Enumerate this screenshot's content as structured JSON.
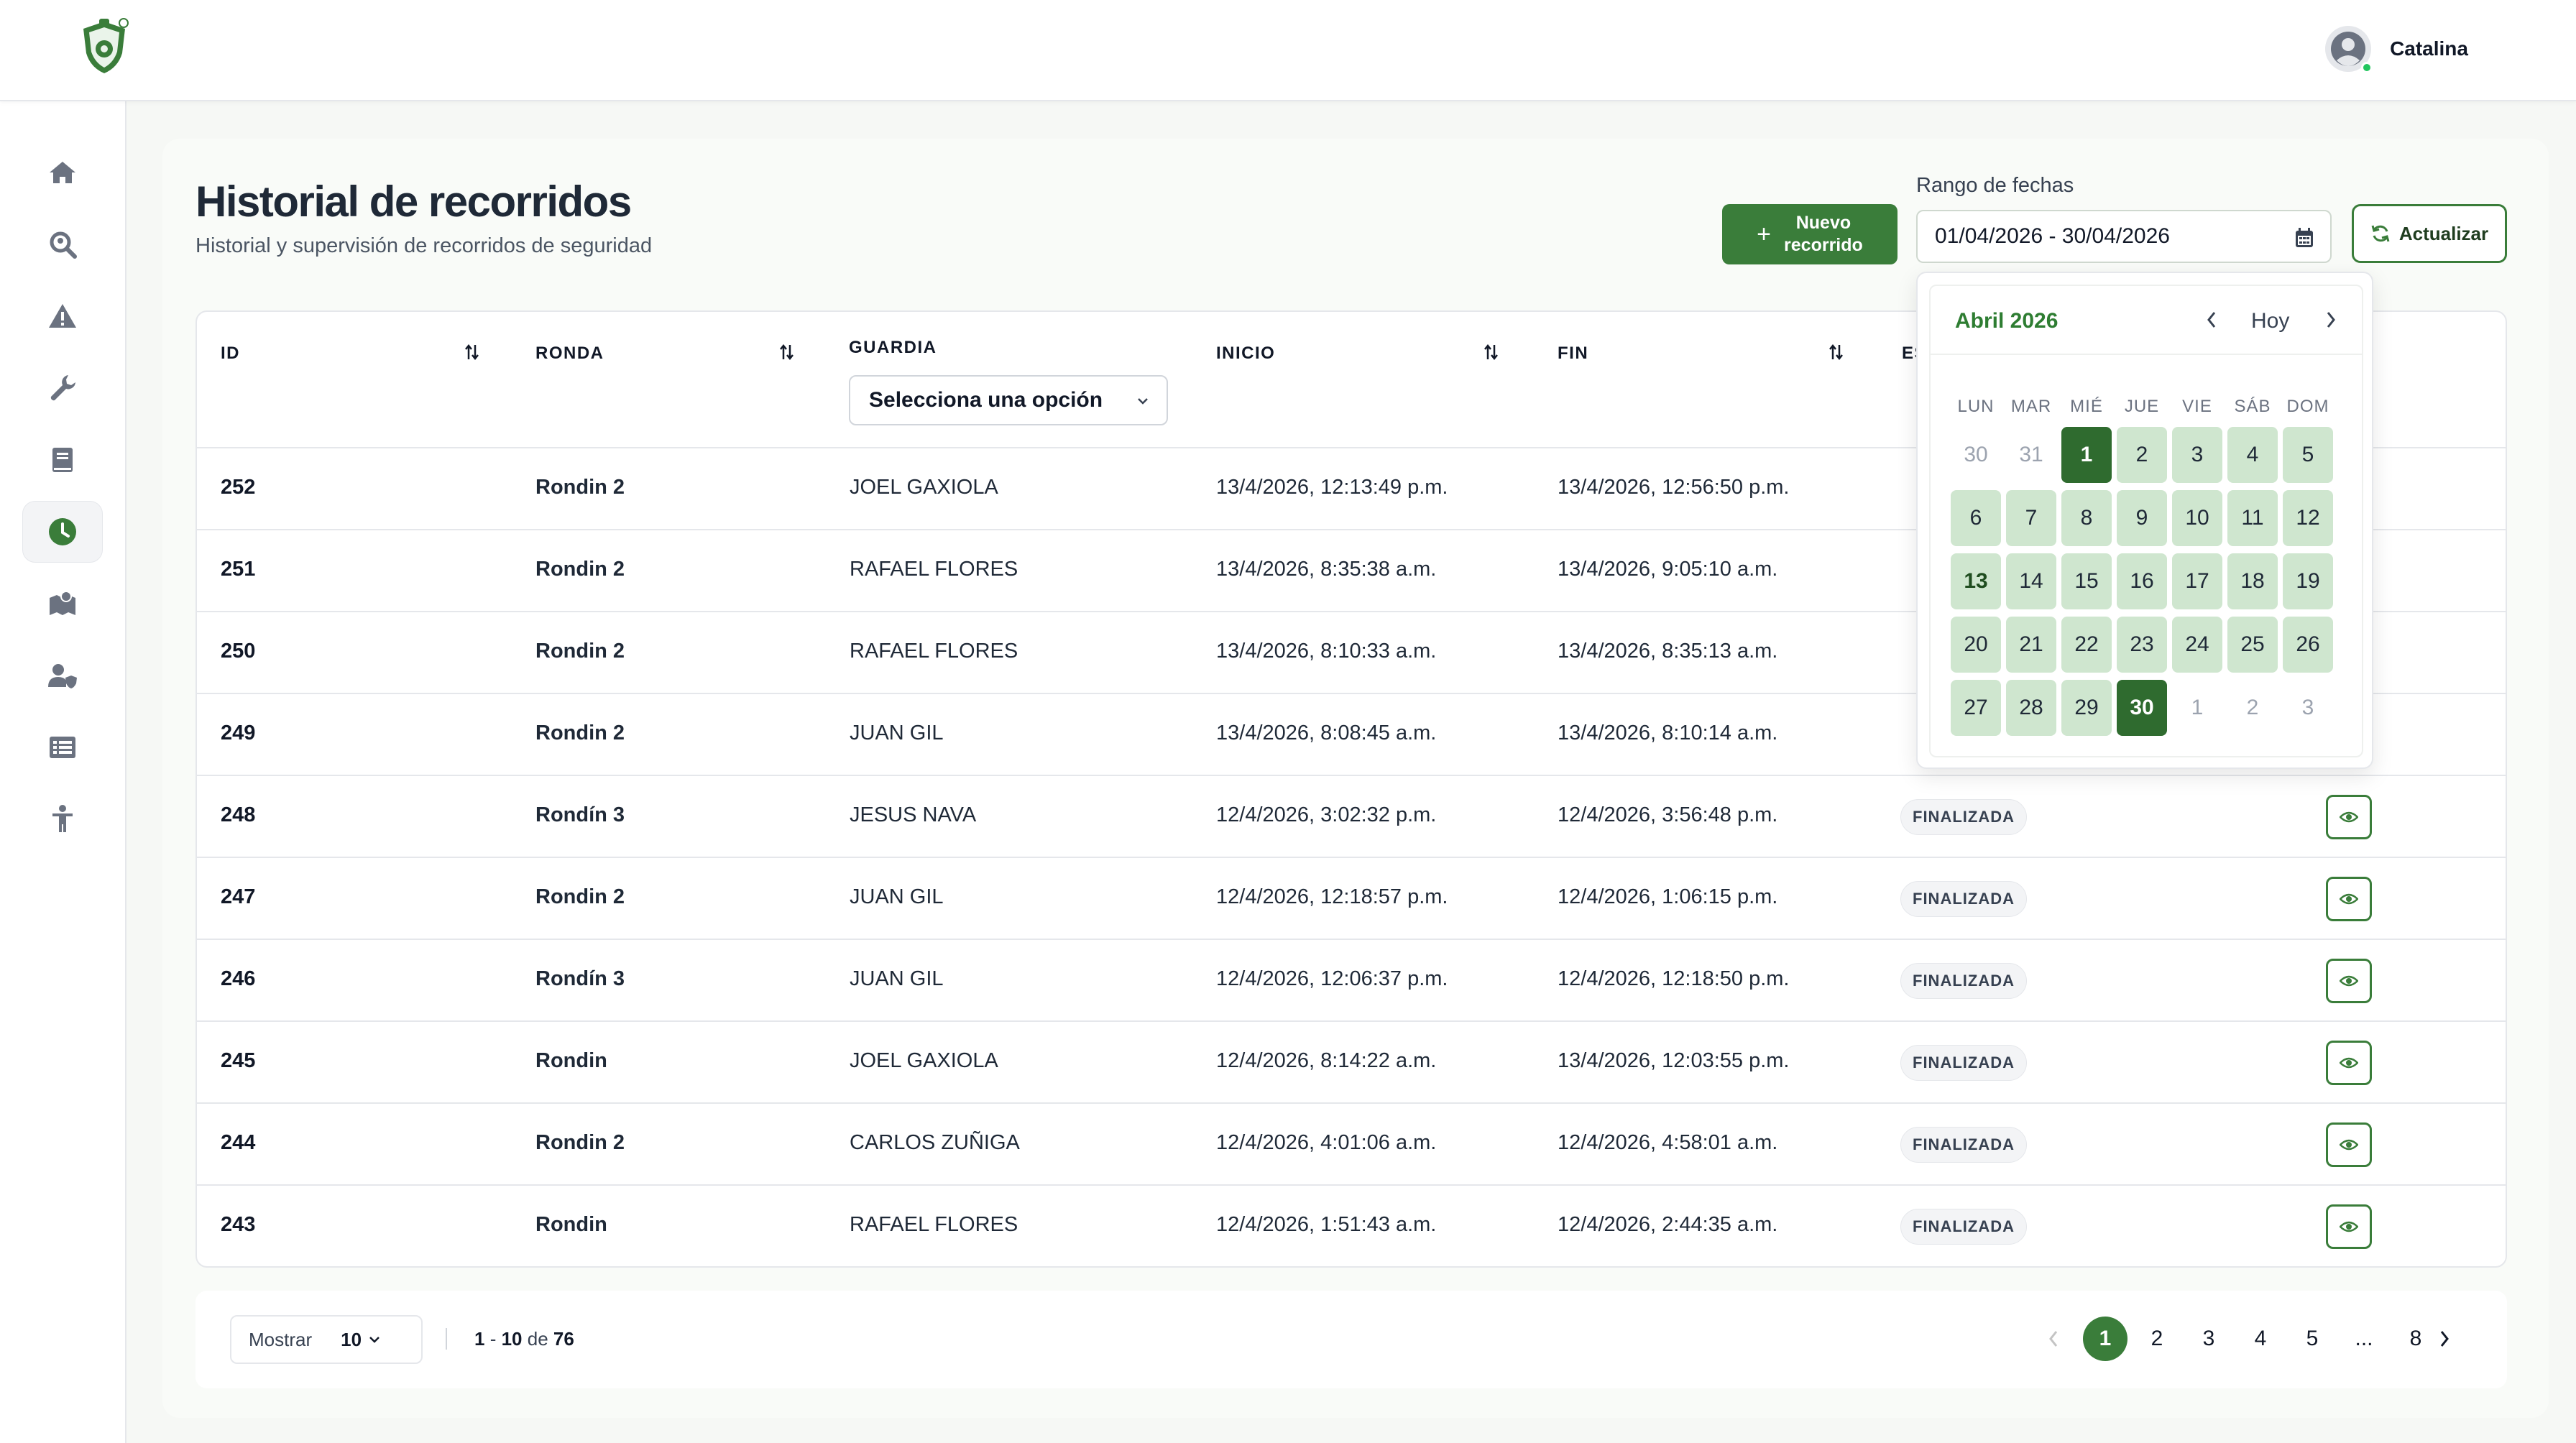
{
  "colors": {
    "accent": "#3a7d3a",
    "accent_dark": "#2f6b2f",
    "range_day_bg": "#cfe6cf",
    "online": "#22c55e"
  },
  "header": {
    "user_name": "Catalina"
  },
  "sidebar": {
    "items": [
      {
        "name": "home",
        "icon": "home-icon"
      },
      {
        "name": "search",
        "icon": "search-location-icon"
      },
      {
        "name": "alerts",
        "icon": "warning-icon"
      },
      {
        "name": "tools",
        "icon": "wrench-icon"
      },
      {
        "name": "logbook",
        "icon": "book-icon"
      },
      {
        "name": "history",
        "icon": "clock-icon",
        "active": true
      },
      {
        "name": "map",
        "icon": "map-icon"
      },
      {
        "name": "users",
        "icon": "user-shield-icon"
      },
      {
        "name": "list",
        "icon": "list-icon"
      },
      {
        "name": "guard",
        "icon": "person-icon"
      }
    ]
  },
  "page": {
    "title": "Historial de recorridos",
    "subtitle": "Historial y supervisión de recorridos de seguridad",
    "new_button": {
      "plus": "+",
      "label": "Nuevo recorrido"
    },
    "range_label": "Rango de fechas",
    "range_value": "01/04/2026 - 30/04/2026",
    "refresh_button": "Actualizar"
  },
  "table": {
    "headers": {
      "id": "ID",
      "ronda": "RONDA",
      "guardia": "GUARDIA",
      "inicio": "INICIO",
      "fin": "FIN",
      "estado": "ES"
    },
    "guardia_filter": "Selecciona una opción",
    "rows": [
      {
        "id": "252",
        "ronda": "Rondin 2",
        "guardia": "JOEL GAXIOLA",
        "inicio": "13/4/2026, 12:13:49 p.m.",
        "fin": "13/4/2026, 12:56:50 p.m.",
        "estado": ""
      },
      {
        "id": "251",
        "ronda": "Rondin 2",
        "guardia": "RAFAEL FLORES",
        "inicio": "13/4/2026, 8:35:38 a.m.",
        "fin": "13/4/2026, 9:05:10 a.m.",
        "estado": ""
      },
      {
        "id": "250",
        "ronda": "Rondin 2",
        "guardia": "RAFAEL FLORES",
        "inicio": "13/4/2026, 8:10:33 a.m.",
        "fin": "13/4/2026, 8:35:13 a.m.",
        "estado": ""
      },
      {
        "id": "249",
        "ronda": "Rondin 2",
        "guardia": "JUAN GIL",
        "inicio": "13/4/2026, 8:08:45 a.m.",
        "fin": "13/4/2026, 8:10:14 a.m.",
        "estado": ""
      },
      {
        "id": "248",
        "ronda": "Rondín 3",
        "guardia": "JESUS NAVA",
        "inicio": "12/4/2026, 3:02:32 p.m.",
        "fin": "12/4/2026, 3:56:48 p.m.",
        "estado": "FINALIZADA"
      },
      {
        "id": "247",
        "ronda": "Rondin 2",
        "guardia": "JUAN GIL",
        "inicio": "12/4/2026, 12:18:57 p.m.",
        "fin": "12/4/2026, 1:06:15 p.m.",
        "estado": "FINALIZADA"
      },
      {
        "id": "246",
        "ronda": "Rondín 3",
        "guardia": "JUAN GIL",
        "inicio": "12/4/2026, 12:06:37 p.m.",
        "fin": "12/4/2026, 12:18:50 p.m.",
        "estado": "FINALIZADA"
      },
      {
        "id": "245",
        "ronda": "Rondin",
        "guardia": "JOEL GAXIOLA",
        "inicio": "12/4/2026, 8:14:22 a.m.",
        "fin": "13/4/2026, 12:03:55 p.m.",
        "estado": "FINALIZADA"
      },
      {
        "id": "244",
        "ronda": "Rondin 2",
        "guardia": "CARLOS ZUÑIGA",
        "inicio": "12/4/2026, 4:01:06 a.m.",
        "fin": "12/4/2026, 4:58:01 a.m.",
        "estado": "FINALIZADA"
      },
      {
        "id": "243",
        "ronda": "Rondin",
        "guardia": "RAFAEL FLORES",
        "inicio": "12/4/2026, 1:51:43 a.m.",
        "fin": "12/4/2026, 2:44:35 a.m.",
        "estado": "FINALIZADA"
      }
    ]
  },
  "pagination": {
    "show_label": "Mostrar",
    "per_page": "10",
    "separator": "|",
    "range_start": "1",
    "range_end": "10",
    "of_label": "de",
    "total": "76",
    "pages": [
      "1",
      "2",
      "3",
      "4",
      "5",
      "...",
      "8"
    ],
    "current_page": "1"
  },
  "calendar": {
    "month_label": "Abril 2026",
    "today_label": "Hoy",
    "weekdays": [
      "LUN",
      "MAR",
      "MIÉ",
      "JUE",
      "VIE",
      "SÁB",
      "DOM"
    ],
    "days": [
      {
        "d": "30",
        "t": "out"
      },
      {
        "d": "31",
        "t": "out"
      },
      {
        "d": "1",
        "t": "sel"
      },
      {
        "d": "2",
        "t": "in"
      },
      {
        "d": "3",
        "t": "in"
      },
      {
        "d": "4",
        "t": "in"
      },
      {
        "d": "5",
        "t": "in"
      },
      {
        "d": "6",
        "t": "in"
      },
      {
        "d": "7",
        "t": "in"
      },
      {
        "d": "8",
        "t": "in"
      },
      {
        "d": "9",
        "t": "in"
      },
      {
        "d": "10",
        "t": "in"
      },
      {
        "d": "11",
        "t": "in"
      },
      {
        "d": "12",
        "t": "in"
      },
      {
        "d": "13",
        "t": "today"
      },
      {
        "d": "14",
        "t": "in"
      },
      {
        "d": "15",
        "t": "in"
      },
      {
        "d": "16",
        "t": "in"
      },
      {
        "d": "17",
        "t": "in"
      },
      {
        "d": "18",
        "t": "in"
      },
      {
        "d": "19",
        "t": "in"
      },
      {
        "d": "20",
        "t": "in"
      },
      {
        "d": "21",
        "t": "in"
      },
      {
        "d": "22",
        "t": "in"
      },
      {
        "d": "23",
        "t": "in"
      },
      {
        "d": "24",
        "t": "in"
      },
      {
        "d": "25",
        "t": "in"
      },
      {
        "d": "26",
        "t": "in"
      },
      {
        "d": "27",
        "t": "in"
      },
      {
        "d": "28",
        "t": "in"
      },
      {
        "d": "29",
        "t": "in"
      },
      {
        "d": "30",
        "t": "sel"
      },
      {
        "d": "1",
        "t": "out"
      },
      {
        "d": "2",
        "t": "out"
      },
      {
        "d": "3",
        "t": "out"
      }
    ]
  }
}
